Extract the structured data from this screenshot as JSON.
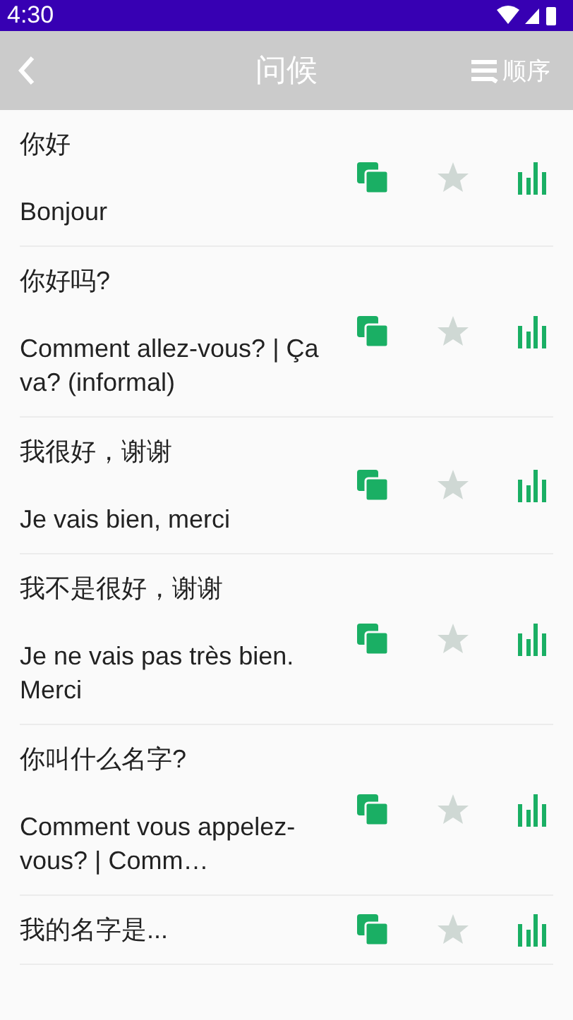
{
  "status_bar": {
    "time": "4:30"
  },
  "toolbar": {
    "title": "问候",
    "sort_label": "顺序"
  },
  "phrases": [
    {
      "chinese": "你好",
      "french": "Bonjour",
      "favorite": false
    },
    {
      "chinese": "你好吗?",
      "french": "Comment allez-vous? | Ça va? (informal)",
      "favorite": false
    },
    {
      "chinese": "我很好，谢谢",
      "french": "Je vais bien, merci",
      "favorite": false
    },
    {
      "chinese": "我不是很好，谢谢",
      "french": "Je ne vais pas très bien. Merci",
      "favorite": false
    },
    {
      "chinese": "你叫什么名字?",
      "french": "Comment vous appelez-vous? | Comm…",
      "favorite": false
    },
    {
      "chinese": "我的名字是...",
      "favorite": false
    }
  ]
}
